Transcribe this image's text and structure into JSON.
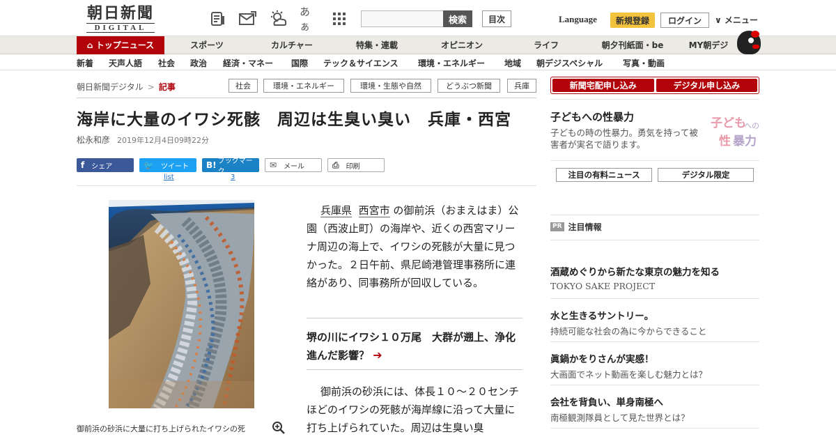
{
  "header": {
    "logo_jp": "朝日新聞",
    "logo_en": "DIGITAL",
    "font_size_label": "あぁ",
    "search_button": "検索",
    "index_button": "目次",
    "language": "Language",
    "register": "新規登録",
    "login": "ログイン",
    "menu": "∨ メニュー"
  },
  "nav_primary": [
    "トップニュース",
    "スポーツ",
    "カルチャー",
    "特集・連載",
    "オピニオン",
    "ライフ",
    "朝夕刊紙面・be",
    "MY朝デジ"
  ],
  "nav_secondary": [
    "新着",
    "天声人語",
    "社会",
    "政治",
    "経済・マネー",
    "国際",
    "テック＆サイエンス",
    "環境・エネルギー",
    "地域",
    "朝デジスペシャル",
    "写真・動画"
  ],
  "breadcrumb": {
    "home": "朝日新聞デジタル",
    "separator": ">",
    "current": "記事"
  },
  "tags": [
    "社会",
    "環境・エネルギー",
    "環境・生態や自然",
    "どうぶつ新聞",
    "兵庫"
  ],
  "article": {
    "title": "海岸に大量のイワシ死骸　周辺は生臭い臭い　兵庫・西宮",
    "author": "松永和彦",
    "date": "2019年12月4日09時22分",
    "share": {
      "facebook": "シェア",
      "twitter": "ツイート",
      "hatena": "ブックマーク",
      "mail": "メール",
      "print": "印刷",
      "twitter_count": "list",
      "hatena_count": "3"
    },
    "caption_line1": "御前浜の砂浜に大量に打ち上げられたイワシの死",
    "para1_link1": "兵庫県",
    "para1_link2": "西宮市",
    "para1_rest": "の御前浜（おまえはま）公園（西波止町）の海岸や、近くの西宮マリーナ周辺の海上で、イワシの死骸が大量に見つかった。２日午前、県尼崎港管理事務所に連絡があり、同事務所が回収している。",
    "related": "堺の川にイワシ１０万尾　大群が遡上、浄化進んだ影響？",
    "para2": "御前浜の砂浜には、体長１０～２０センチほどのイワシの死骸が海岸線に沿って大量に打ち上げられていた。周辺は生臭い臭"
  },
  "sidebar": {
    "apply_paper": "新聞宅配申し込み",
    "apply_digital": "デジタル申し込み",
    "feature_title": "子どもへの性暴力",
    "feature_desc": "子どもの時の性暴力。勇気を持って被害者が実名で語ります。",
    "feature_logo_a": "子ども",
    "feature_logo_b": "への",
    "feature_logo_c": "性",
    "feature_logo_d": "暴力",
    "tab_paid": "注目の有料ニュース",
    "tab_digital": "デジタル限定",
    "pr_badge": "PR",
    "pr_heading": "注目情報",
    "ads": [
      {
        "title": "酒蔵めぐりから新たな東京の魅力を知る",
        "sub": "TOKYO SAKE PROJECT"
      },
      {
        "title": "水と生きるサントリー。",
        "sub": "持続可能な社会の為に今からできること"
      },
      {
        "title": "眞鍋かをりさんが実感！",
        "sub": "大画面でネット動画を楽しむ魅力とは？"
      },
      {
        "title": "会社を背負い、単身南極へ",
        "sub": "南極観測隊員として見た世界とは？"
      }
    ]
  },
  "colors": {
    "brand_red": "#b2030b",
    "register_yellow": "#f3c33d",
    "facebook": "#3b5998",
    "twitter": "#1da1f2",
    "hatena": "#1b82c5"
  }
}
